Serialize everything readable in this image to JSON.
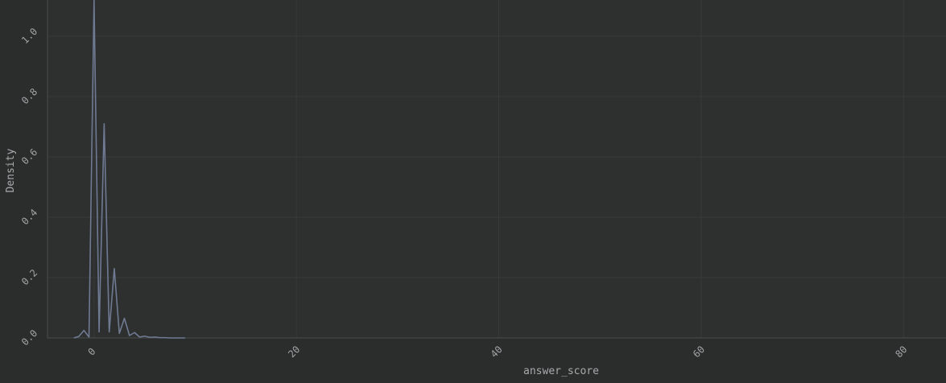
{
  "chart_data": {
    "type": "line",
    "title": "",
    "xlabel": "answer_score",
    "ylabel": "Density",
    "xlim": [
      -4.6,
      84.2
    ],
    "ylim": [
      0,
      1.12
    ],
    "xticks": [
      0,
      20,
      40,
      60,
      80
    ],
    "yticks": [
      0.0,
      0.2,
      0.4,
      0.6,
      0.8,
      1.0
    ],
    "xtick_labels": [
      "0",
      "20",
      "40",
      "60",
      "80"
    ],
    "ytick_labels": [
      "0.0",
      "0.2",
      "0.4",
      "0.6",
      "0.8",
      "1.0"
    ],
    "grid": true,
    "legend": "none",
    "colors": {
      "background": "#2b2d2d",
      "plot_background": "#2e3030",
      "grid": "#383a3a",
      "axis": "#4a4d4d",
      "line": "#6f7a92",
      "text": "#a0a4a4"
    },
    "series": [
      {
        "x": [
          -2.0,
          -1.5,
          -1.0,
          -0.5,
          0.0,
          0.5,
          1.0,
          1.5,
          2.0,
          2.5,
          3.0,
          3.5,
          4.0,
          4.5,
          5.0,
          5.5,
          6.0,
          6.5,
          7.0,
          7.5,
          8.0,
          9.0
        ],
        "y": [
          0.0,
          0.005,
          0.025,
          0.003,
          1.12,
          0.02,
          0.71,
          0.02,
          0.23,
          0.015,
          0.065,
          0.008,
          0.018,
          0.003,
          0.006,
          0.002,
          0.003,
          0.001,
          0.001,
          0.0,
          0.0,
          0.0
        ]
      }
    ]
  }
}
